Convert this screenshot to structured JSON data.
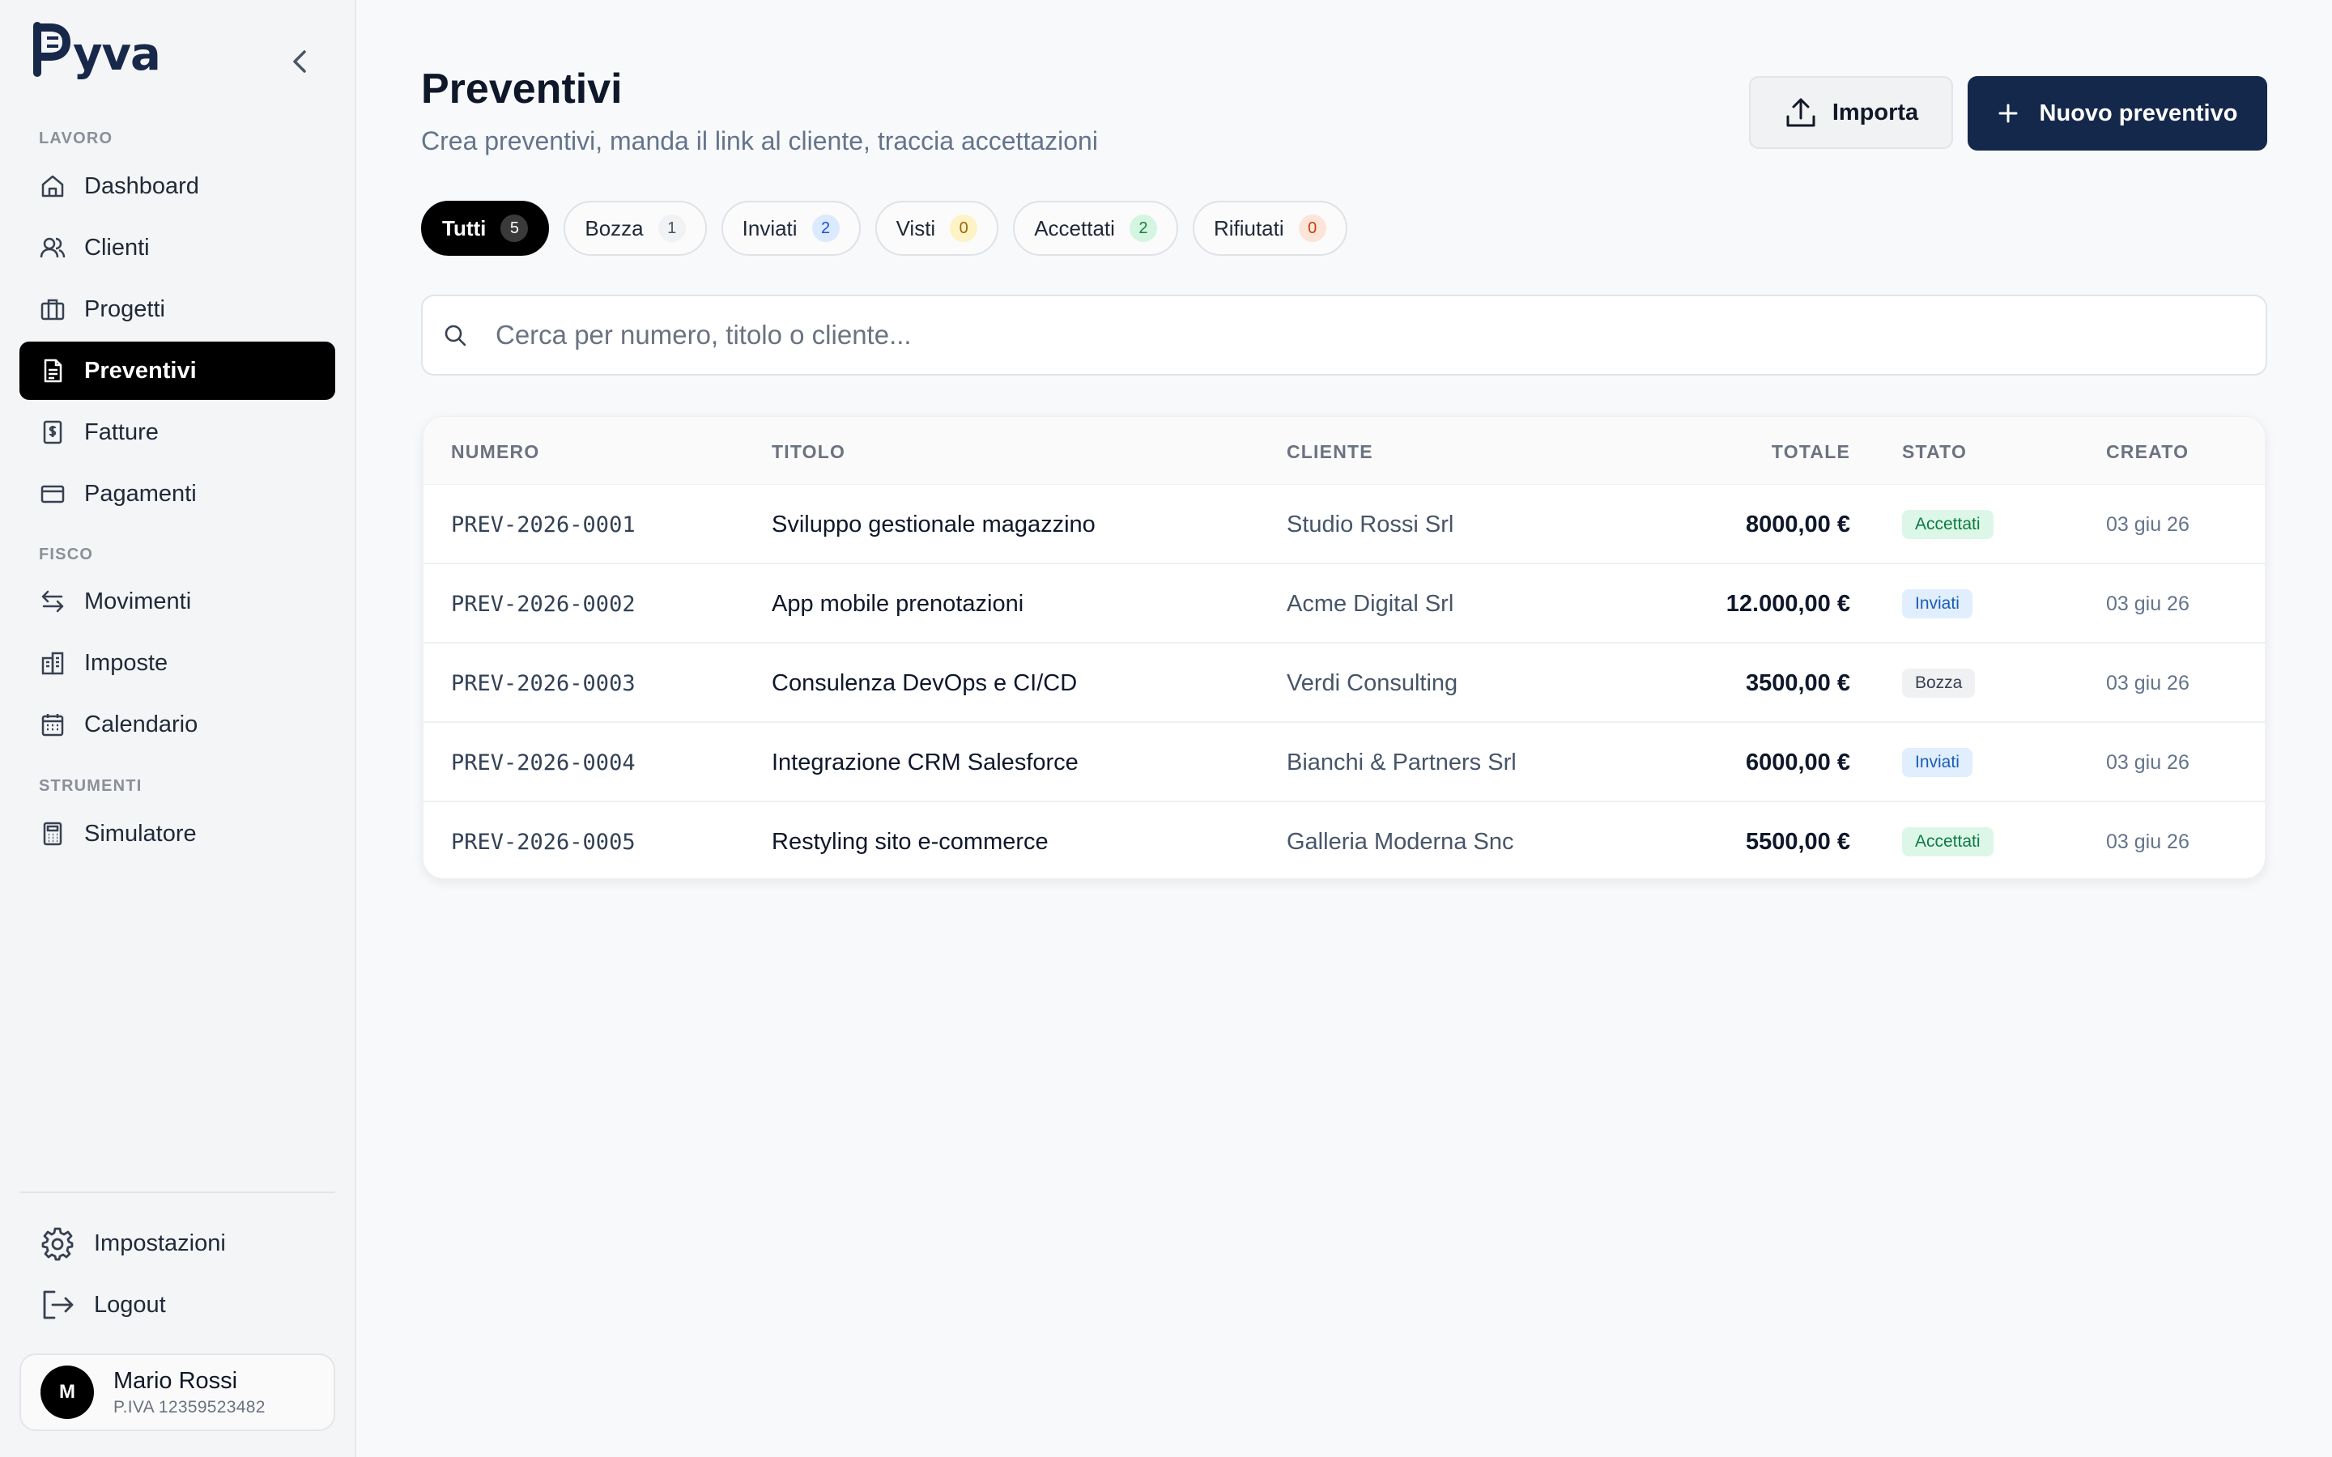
{
  "app": {
    "logo_text": "yva"
  },
  "sidebar": {
    "sections": {
      "lavoro": "LAVORO",
      "fisco": "FISCO",
      "strumenti": "STRUMENTI"
    },
    "items": [
      {
        "label": "Dashboard",
        "icon": "home-icon"
      },
      {
        "label": "Clienti",
        "icon": "users-icon"
      },
      {
        "label": "Progetti",
        "icon": "briefcase-icon"
      },
      {
        "label": "Preventivi",
        "icon": "document-icon",
        "active": true
      },
      {
        "label": "Fatture",
        "icon": "receipt-icon"
      },
      {
        "label": "Pagamenti",
        "icon": "credit-card-icon"
      },
      {
        "label": "Movimenti",
        "icon": "arrows-swap-icon"
      },
      {
        "label": "Imposte",
        "icon": "building-icon"
      },
      {
        "label": "Calendario",
        "icon": "calendar-icon"
      },
      {
        "label": "Simulatore",
        "icon": "calculator-icon"
      }
    ],
    "bottom": {
      "settings": "Impostazioni",
      "logout": "Logout"
    },
    "user": {
      "initial": "M",
      "name": "Mario Rossi",
      "vat": "P.IVA 12359523482"
    }
  },
  "header": {
    "title": "Preventivi",
    "subtitle": "Crea preventivi, manda il link al cliente, traccia accettazioni",
    "import_label": "Importa",
    "new_label": "Nuovo preventivo"
  },
  "filters": [
    {
      "label": "Tutti",
      "count": "5",
      "count_bg": "#3a3a3a",
      "count_color": "#ffffff"
    },
    {
      "label": "Bozza",
      "count": "1",
      "count_bg": "#f1f2f4",
      "count_color": "#4b5563"
    },
    {
      "label": "Inviati",
      "count": "2",
      "count_bg": "#dbeafe",
      "count_color": "#1d4ed8"
    },
    {
      "label": "Visti",
      "count": "0",
      "count_bg": "#fdf3c4",
      "count_color": "#a16207"
    },
    {
      "label": "Accettati",
      "count": "2",
      "count_bg": "#d5f5e3",
      "count_color": "#15803d"
    },
    {
      "label": "Rifiutati",
      "count": "0",
      "count_bg": "#fde4d8",
      "count_color": "#c2410c"
    }
  ],
  "search": {
    "placeholder": "Cerca per numero, titolo o cliente..."
  },
  "table": {
    "columns": {
      "numero": "NUMERO",
      "titolo": "TITOLO",
      "cliente": "CLIENTE",
      "totale": "TOTALE",
      "stato": "STATO",
      "creato": "CREATO"
    },
    "rows": [
      {
        "numero": "PREV-2026-0001",
        "titolo": "Sviluppo gestionale magazzino",
        "cliente": "Studio Rossi Srl",
        "totale": "8000,00 €",
        "stato": "Accettati",
        "stato_key": "accettati",
        "creato": "03 giu 26"
      },
      {
        "numero": "PREV-2026-0002",
        "titolo": "App mobile prenotazioni",
        "cliente": "Acme Digital Srl",
        "totale": "12.000,00 €",
        "stato": "Inviati",
        "stato_key": "inviati",
        "creato": "03 giu 26"
      },
      {
        "numero": "PREV-2026-0003",
        "titolo": "Consulenza DevOps e CI/CD",
        "cliente": "Verdi Consulting",
        "totale": "3500,00 €",
        "stato": "Bozza",
        "stato_key": "bozza",
        "creato": "03 giu 26"
      },
      {
        "numero": "PREV-2026-0004",
        "titolo": "Integrazione CRM Salesforce",
        "cliente": "Bianchi & Partners Srl",
        "totale": "6000,00 €",
        "stato": "Inviati",
        "stato_key": "inviati",
        "creato": "03 giu 26"
      },
      {
        "numero": "PREV-2026-0005",
        "titolo": "Restyling sito e-commerce",
        "cliente": "Galleria Moderna Snc",
        "totale": "5500,00 €",
        "stato": "Accettati",
        "stato_key": "accettati",
        "creato": "03 giu 26"
      }
    ]
  },
  "colors": {
    "accent": "#14284b",
    "active_nav": "#000000"
  }
}
